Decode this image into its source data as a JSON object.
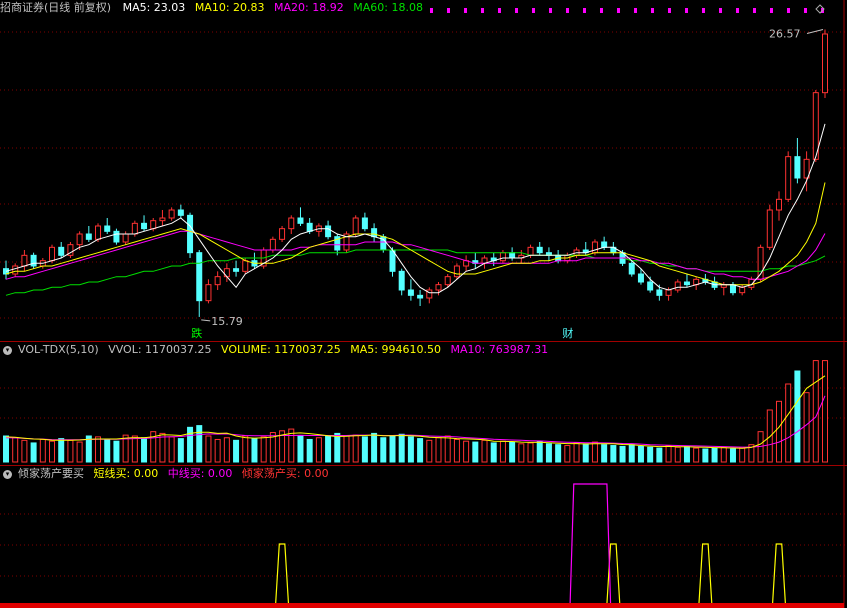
{
  "window": {
    "title": "招商证券(日线 前复权)"
  },
  "main_header": {
    "ma5": "MA5: 23.03",
    "ma10": "MA10: 20.83",
    "ma20": "MA20: 18.92",
    "ma60": "MA60: 18.08"
  },
  "vol_header": {
    "name": "VOL-TDX(5,10)",
    "vvol": "VVOL: 1170037.25",
    "volume": "VOLUME: 1170037.25",
    "ma5": "MA5: 994610.50",
    "ma10": "MA10: 763987.31"
  },
  "ind_header": {
    "name": "倾家荡产要买",
    "short": "短线买: 0.00",
    "mid": "中线买: 0.00",
    "all": "倾家荡产买: 0.00"
  },
  "colors": {
    "up": "#ff3232",
    "down": "#54ffff",
    "ma5": "#ffffff",
    "ma10": "#ffff00",
    "ma20": "#ff00ff",
    "ma60": "#00e000",
    "grid": "#800000",
    "bg": "#000000"
  },
  "chart_data": [
    {
      "type": "candlestick",
      "title": "招商证券(日线 前复权)",
      "annotations": {
        "high_label": "26.57",
        "low_label": "15.79",
        "marker_fall": "跌",
        "marker_finance": "财"
      },
      "ylim": [
        15.0,
        27.0
      ],
      "ohlc": [
        [
          17.6,
          17.9,
          17.2,
          17.4
        ],
        [
          17.4,
          17.8,
          17.3,
          17.7
        ],
        [
          17.7,
          18.3,
          17.5,
          18.1
        ],
        [
          18.1,
          18.2,
          17.6,
          17.7
        ],
        [
          17.7,
          18.0,
          17.6,
          17.9
        ],
        [
          17.9,
          18.5,
          17.8,
          18.4
        ],
        [
          18.4,
          18.6,
          18.0,
          18.1
        ],
        [
          18.1,
          18.6,
          18.0,
          18.5
        ],
        [
          18.5,
          19.0,
          18.3,
          18.9
        ],
        [
          18.9,
          19.2,
          18.6,
          18.7
        ],
        [
          18.7,
          19.3,
          18.6,
          19.2
        ],
        [
          19.2,
          19.5,
          18.9,
          19.0
        ],
        [
          19.0,
          19.1,
          18.5,
          18.6
        ],
        [
          18.6,
          19.0,
          18.5,
          18.9
        ],
        [
          18.9,
          19.4,
          18.8,
          19.3
        ],
        [
          19.3,
          19.6,
          19.0,
          19.1
        ],
        [
          19.1,
          19.5,
          19.0,
          19.4
        ],
        [
          19.4,
          19.8,
          19.2,
          19.5
        ],
        [
          19.5,
          19.9,
          19.4,
          19.8
        ],
        [
          19.8,
          20.0,
          19.5,
          19.6
        ],
        [
          19.6,
          19.7,
          18.0,
          18.2
        ],
        [
          18.2,
          18.3,
          15.79,
          16.4
        ],
        [
          16.4,
          17.2,
          16.3,
          17.0
        ],
        [
          17.0,
          17.5,
          16.8,
          17.3
        ],
        [
          17.3,
          17.8,
          17.1,
          17.6
        ],
        [
          17.6,
          17.9,
          17.3,
          17.5
        ],
        [
          17.5,
          18.0,
          17.4,
          17.9
        ],
        [
          17.9,
          18.2,
          17.6,
          17.7
        ],
        [
          17.7,
          18.4,
          17.6,
          18.3
        ],
        [
          18.3,
          18.8,
          18.2,
          18.7
        ],
        [
          18.7,
          19.2,
          18.6,
          19.1
        ],
        [
          19.1,
          19.6,
          18.9,
          19.5
        ],
        [
          19.5,
          19.9,
          19.2,
          19.3
        ],
        [
          19.3,
          19.5,
          18.9,
          19.0
        ],
        [
          19.0,
          19.3,
          18.8,
          19.2
        ],
        [
          19.2,
          19.4,
          18.7,
          18.8
        ],
        [
          18.8,
          18.9,
          18.1,
          18.3
        ],
        [
          18.3,
          19.0,
          18.2,
          18.9
        ],
        [
          18.9,
          19.6,
          18.8,
          19.5
        ],
        [
          19.5,
          19.7,
          19.0,
          19.1
        ],
        [
          19.1,
          19.3,
          18.6,
          18.8
        ],
        [
          18.8,
          18.9,
          18.2,
          18.3
        ],
        [
          18.3,
          18.4,
          17.3,
          17.5
        ],
        [
          17.5,
          17.6,
          16.6,
          16.8
        ],
        [
          16.8,
          17.2,
          16.4,
          16.6
        ],
        [
          16.6,
          16.8,
          16.2,
          16.5
        ],
        [
          16.5,
          16.9,
          16.3,
          16.8
        ],
        [
          16.8,
          17.1,
          16.6,
          17.0
        ],
        [
          17.0,
          17.4,
          16.9,
          17.3
        ],
        [
          17.3,
          17.8,
          17.2,
          17.7
        ],
        [
          17.7,
          18.1,
          17.5,
          17.9
        ],
        [
          17.9,
          18.2,
          17.6,
          17.8
        ],
        [
          17.8,
          18.1,
          17.6,
          18.0
        ],
        [
          18.0,
          18.2,
          17.7,
          17.9
        ],
        [
          17.9,
          18.3,
          17.8,
          18.2
        ],
        [
          18.2,
          18.4,
          17.9,
          18.0
        ],
        [
          18.0,
          18.3,
          17.8,
          18.1
        ],
        [
          18.1,
          18.5,
          18.0,
          18.4
        ],
        [
          18.4,
          18.6,
          18.1,
          18.2
        ],
        [
          18.2,
          18.4,
          17.9,
          18.1
        ],
        [
          18.1,
          18.3,
          17.8,
          17.9
        ],
        [
          17.9,
          18.2,
          17.8,
          18.1
        ],
        [
          18.1,
          18.4,
          18.0,
          18.3
        ],
        [
          18.3,
          18.6,
          18.1,
          18.2
        ],
        [
          18.2,
          18.7,
          18.1,
          18.6
        ],
        [
          18.6,
          18.8,
          18.3,
          18.4
        ],
        [
          18.4,
          18.6,
          18.1,
          18.2
        ],
        [
          18.2,
          18.3,
          17.7,
          17.8
        ],
        [
          17.8,
          17.9,
          17.3,
          17.4
        ],
        [
          17.4,
          17.6,
          17.0,
          17.1
        ],
        [
          17.1,
          17.3,
          16.7,
          16.8
        ],
        [
          16.8,
          17.0,
          16.4,
          16.6
        ],
        [
          16.6,
          16.9,
          16.4,
          16.8
        ],
        [
          16.8,
          17.2,
          16.7,
          17.1
        ],
        [
          17.1,
          17.4,
          16.9,
          17.0
        ],
        [
          17.0,
          17.3,
          16.8,
          17.2
        ],
        [
          17.2,
          17.4,
          17.0,
          17.1
        ],
        [
          17.1,
          17.3,
          16.8,
          16.9
        ],
        [
          16.9,
          17.1,
          16.6,
          17.0
        ],
        [
          17.0,
          17.1,
          16.6,
          16.7
        ],
        [
          16.7,
          17.0,
          16.6,
          16.9
        ],
        [
          16.9,
          17.3,
          16.8,
          17.2
        ],
        [
          17.2,
          18.5,
          17.1,
          18.4
        ],
        [
          18.4,
          20.0,
          18.3,
          19.8
        ],
        [
          19.8,
          20.5,
          19.4,
          20.2
        ],
        [
          20.2,
          22.0,
          20.1,
          21.8
        ],
        [
          21.8,
          22.5,
          20.8,
          21.0
        ],
        [
          21.0,
          22.0,
          20.5,
          21.7
        ],
        [
          21.7,
          24.3,
          21.6,
          24.2
        ],
        [
          24.2,
          26.57,
          24.0,
          26.4
        ]
      ],
      "ma5": [
        17.5,
        17.6,
        17.7,
        17.8,
        17.8,
        17.9,
        18.0,
        18.2,
        18.4,
        18.5,
        18.7,
        18.8,
        18.9,
        18.9,
        18.9,
        19.0,
        19.1,
        19.2,
        19.3,
        19.5,
        19.2,
        18.7,
        18.2,
        17.7,
        17.3,
        16.9,
        17.4,
        17.6,
        17.8,
        18.0,
        18.3,
        18.7,
        18.9,
        19.0,
        19.1,
        19.1,
        18.9,
        18.8,
        18.8,
        18.9,
        18.8,
        18.7,
        18.3,
        17.8,
        17.3,
        16.9,
        16.7,
        16.7,
        16.9,
        17.2,
        17.5,
        17.6,
        17.8,
        17.9,
        18.0,
        18.0,
        18.0,
        18.1,
        18.1,
        18.1,
        18.1,
        18.1,
        18.2,
        18.2,
        18.3,
        18.4,
        18.4,
        18.2,
        17.9,
        17.6,
        17.2,
        16.9,
        16.8,
        16.9,
        16.9,
        17.0,
        17.1,
        17.0,
        17.0,
        17.0,
        16.9,
        17.0,
        17.4,
        18.0,
        18.8,
        19.6,
        20.2,
        20.9,
        21.8,
        23.03
      ],
      "ma10": [
        17.4,
        17.5,
        17.5,
        17.6,
        17.7,
        17.7,
        17.8,
        17.9,
        18.0,
        18.1,
        18.2,
        18.3,
        18.4,
        18.5,
        18.6,
        18.7,
        18.8,
        18.9,
        19.0,
        19.1,
        19.0,
        18.9,
        18.7,
        18.5,
        18.3,
        18.1,
        17.9,
        17.8,
        17.8,
        17.8,
        17.9,
        18.0,
        18.2,
        18.4,
        18.5,
        18.6,
        18.7,
        18.8,
        18.9,
        18.9,
        18.9,
        18.8,
        18.7,
        18.5,
        18.3,
        18.1,
        17.9,
        17.7,
        17.5,
        17.4,
        17.4,
        17.4,
        17.5,
        17.6,
        17.7,
        17.8,
        17.8,
        17.8,
        17.9,
        17.9,
        18.0,
        18.0,
        18.1,
        18.1,
        18.2,
        18.2,
        18.2,
        18.2,
        18.1,
        18.0,
        17.9,
        17.7,
        17.6,
        17.5,
        17.4,
        17.3,
        17.2,
        17.1,
        17.0,
        17.0,
        17.0,
        17.0,
        17.1,
        17.3,
        17.5,
        17.8,
        18.1,
        18.6,
        19.3,
        20.83
      ],
      "ma20": [
        17.2,
        17.3,
        17.3,
        17.4,
        17.5,
        17.6,
        17.7,
        17.8,
        17.9,
        18.0,
        18.1,
        18.2,
        18.3,
        18.4,
        18.5,
        18.6,
        18.7,
        18.8,
        18.9,
        19.0,
        19.0,
        18.9,
        18.8,
        18.7,
        18.6,
        18.5,
        18.4,
        18.3,
        18.3,
        18.3,
        18.3,
        18.3,
        18.4,
        18.4,
        18.5,
        18.5,
        18.5,
        18.5,
        18.5,
        18.6,
        18.6,
        18.6,
        18.6,
        18.5,
        18.5,
        18.4,
        18.3,
        18.2,
        18.1,
        18.0,
        17.9,
        17.8,
        17.8,
        17.8,
        17.8,
        17.8,
        17.8,
        17.8,
        17.8,
        17.8,
        17.9,
        17.9,
        17.9,
        18.0,
        18.0,
        18.0,
        18.0,
        18.0,
        18.0,
        17.9,
        17.9,
        17.8,
        17.8,
        17.7,
        17.6,
        17.6,
        17.5,
        17.4,
        17.4,
        17.3,
        17.3,
        17.2,
        17.2,
        17.3,
        17.4,
        17.5,
        17.7,
        17.9,
        18.3,
        18.92
      ],
      "ma60": [
        16.6,
        16.7,
        16.7,
        16.8,
        16.8,
        16.9,
        16.9,
        17.0,
        17.0,
        17.1,
        17.1,
        17.2,
        17.3,
        17.3,
        17.4,
        17.5,
        17.5,
        17.6,
        17.7,
        17.7,
        17.8,
        17.8,
        17.9,
        17.9,
        17.9,
        18.0,
        18.0,
        18.0,
        18.0,
        18.1,
        18.1,
        18.1,
        18.1,
        18.2,
        18.2,
        18.2,
        18.2,
        18.2,
        18.3,
        18.3,
        18.3,
        18.3,
        18.3,
        18.3,
        18.3,
        18.3,
        18.3,
        18.3,
        18.3,
        18.2,
        18.2,
        18.2,
        18.2,
        18.2,
        18.2,
        18.2,
        18.2,
        18.1,
        18.1,
        18.1,
        18.1,
        18.1,
        18.1,
        18.1,
        18.0,
        18.0,
        18.0,
        18.0,
        17.9,
        17.9,
        17.8,
        17.8,
        17.7,
        17.7,
        17.6,
        17.6,
        17.5,
        17.5,
        17.5,
        17.5,
        17.5,
        17.5,
        17.5,
        17.6,
        17.6,
        17.7,
        17.7,
        17.8,
        17.9,
        18.08
      ]
    },
    {
      "type": "bar",
      "title": "VOL-TDX(5,10)",
      "ylim": [
        0,
        1200000
      ],
      "values": [
        300000,
        280000,
        250000,
        220000,
        260000,
        240000,
        270000,
        250000,
        230000,
        300000,
        290000,
        260000,
        240000,
        310000,
        300000,
        280000,
        350000,
        330000,
        290000,
        270000,
        400000,
        420000,
        300000,
        260000,
        280000,
        250000,
        300000,
        270000,
        290000,
        340000,
        360000,
        380000,
        300000,
        260000,
        280000,
        300000,
        330000,
        300000,
        310000,
        290000,
        330000,
        280000,
        300000,
        320000,
        290000,
        270000,
        250000,
        280000,
        300000,
        260000,
        240000,
        230000,
        250000,
        220000,
        240000,
        230000,
        210000,
        220000,
        240000,
        210000,
        200000,
        190000,
        220000,
        210000,
        230000,
        200000,
        190000,
        180000,
        200000,
        180000,
        170000,
        160000,
        190000,
        170000,
        180000,
        160000,
        150000,
        160000,
        170000,
        150000,
        160000,
        200000,
        350000,
        600000,
        700000,
        900000,
        1050000,
        800000,
        1170037.25,
        1170037.25
      ],
      "ma5": [
        290000,
        285000,
        275000,
        265000,
        262000,
        250000,
        250000,
        252000,
        254000,
        262000,
        265000,
        265000,
        265000,
        276000,
        282000,
        280000,
        292000,
        314000,
        312000,
        306000,
        330000,
        344000,
        344000,
        330000,
        334000,
        300000,
        282000,
        276000,
        280000,
        288000,
        312000,
        330000,
        336000,
        328000,
        316000,
        304000,
        294000,
        296000,
        304000,
        306000,
        312000,
        304000,
        302000,
        306000,
        304000,
        298000,
        286000,
        282000,
        278000,
        270000,
        266000,
        262000,
        256000,
        240000,
        238000,
        236000,
        230000,
        226000,
        228000,
        222000,
        216000,
        212000,
        212000,
        208000,
        210000,
        210000,
        210000,
        202000,
        200000,
        190000,
        184000,
        178000,
        180000,
        176000,
        176000,
        172000,
        170000,
        166000,
        164000,
        162000,
        158000,
        168000,
        208000,
        292000,
        402000,
        550000,
        700000,
        850000,
        922000,
        994610.5
      ],
      "ma10": [
        280000,
        278000,
        272000,
        266000,
        264000,
        258000,
        256000,
        256000,
        256000,
        260000,
        262000,
        262000,
        262000,
        266000,
        270000,
        272000,
        278000,
        288000,
        292000,
        294000,
        306000,
        316000,
        324000,
        322000,
        324000,
        314000,
        306000,
        302000,
        302000,
        304000,
        306000,
        306000,
        308000,
        306000,
        306000,
        306000,
        306000,
        306000,
        310000,
        310000,
        310000,
        306000,
        306000,
        310000,
        310000,
        306000,
        300000,
        296000,
        294000,
        290000,
        282000,
        276000,
        270000,
        262000,
        258000,
        254000,
        250000,
        246000,
        244000,
        238000,
        232000,
        228000,
        226000,
        222000,
        222000,
        220000,
        218000,
        214000,
        212000,
        206000,
        200000,
        196000,
        194000,
        190000,
        188000,
        186000,
        184000,
        180000,
        178000,
        174000,
        172000,
        172000,
        180000,
        200000,
        230000,
        280000,
        350000,
        430000,
        520000,
        763987.31
      ]
    },
    {
      "type": "line",
      "title": "倾家荡产要买",
      "ylim": [
        0,
        2
      ],
      "series": [
        {
          "name": "短线买",
          "pulses_at": [
            30,
            66,
            76,
            84
          ]
        },
        {
          "name": "中线买",
          "pulses_at": [
            62,
            63,
            64,
            65
          ]
        },
        {
          "name": "倾家荡产买",
          "pulses_at": []
        }
      ]
    }
  ]
}
